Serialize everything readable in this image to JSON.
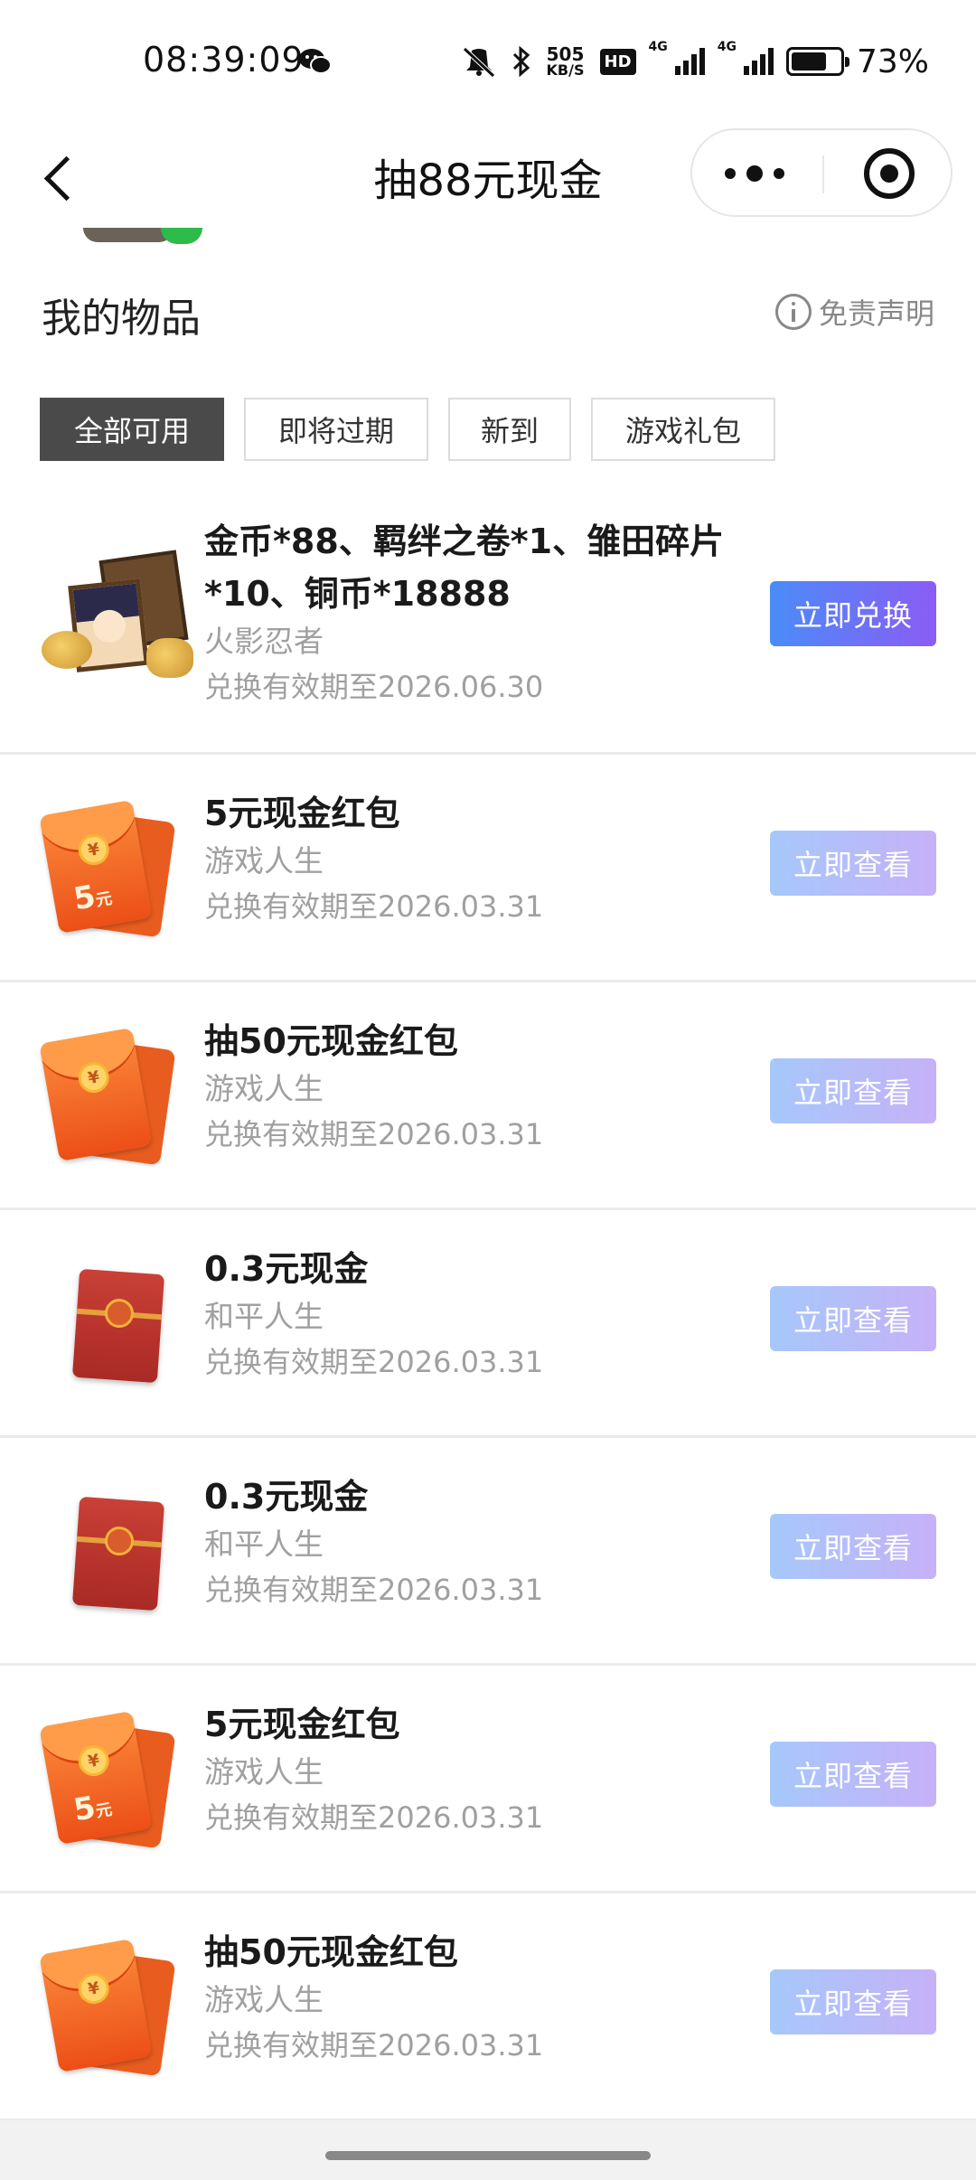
{
  "status_bar": {
    "time": "08:39:09",
    "net_speed_value": "505",
    "net_speed_unit": "KB/S",
    "hd_label": "HD",
    "net_type_1": "4G",
    "net_type_2": "4G",
    "battery_level": 0.73,
    "battery_text": "73%"
  },
  "nav": {
    "title": "抽88元现金"
  },
  "section": {
    "title": "我的物品",
    "disclaimer": "免责声明"
  },
  "tabs": [
    {
      "label": "全部可用",
      "active": true
    },
    {
      "label": "即将过期",
      "active": false
    },
    {
      "label": "新到",
      "active": false
    },
    {
      "label": "游戏礼包",
      "active": false
    }
  ],
  "items": [
    {
      "icon": "game-bundle-icon",
      "name": "金币*88、羁绊之卷*1、雏田碎片*10、铜币*18888",
      "game": "火影忍者",
      "expiry": "兑换有效期至2026.06.30",
      "button": "立即兑换",
      "button_style": "primary"
    },
    {
      "icon": "red-envelope-5-icon",
      "name": "5元现金红包",
      "game": "游戏人生",
      "expiry": "兑换有效期至2026.03.31",
      "button": "立即查看",
      "button_style": "light",
      "amount": "5",
      "amount_unit": "元"
    },
    {
      "icon": "red-envelope-icon",
      "name": "抽50元现金红包",
      "game": "游戏人生",
      "expiry": "兑换有效期至2026.03.31",
      "button": "立即查看",
      "button_style": "light"
    },
    {
      "icon": "red-packet-icon",
      "name": "0.3元现金",
      "game": "和平人生",
      "expiry": "兑换有效期至2026.03.31",
      "button": "立即查看",
      "button_style": "light"
    },
    {
      "icon": "red-packet-icon",
      "name": "0.3元现金",
      "game": "和平人生",
      "expiry": "兑换有效期至2026.03.31",
      "button": "立即查看",
      "button_style": "light"
    },
    {
      "icon": "red-envelope-5-icon",
      "name": "5元现金红包",
      "game": "游戏人生",
      "expiry": "兑换有效期至2026.03.31",
      "button": "立即查看",
      "button_style": "light",
      "amount": "5",
      "amount_unit": "元"
    },
    {
      "icon": "red-envelope-icon",
      "name": "抽50元现金红包",
      "game": "游戏人生",
      "expiry": "兑换有效期至2026.03.31",
      "button": "立即查看",
      "button_style": "light"
    }
  ],
  "coin_symbol": "¥"
}
